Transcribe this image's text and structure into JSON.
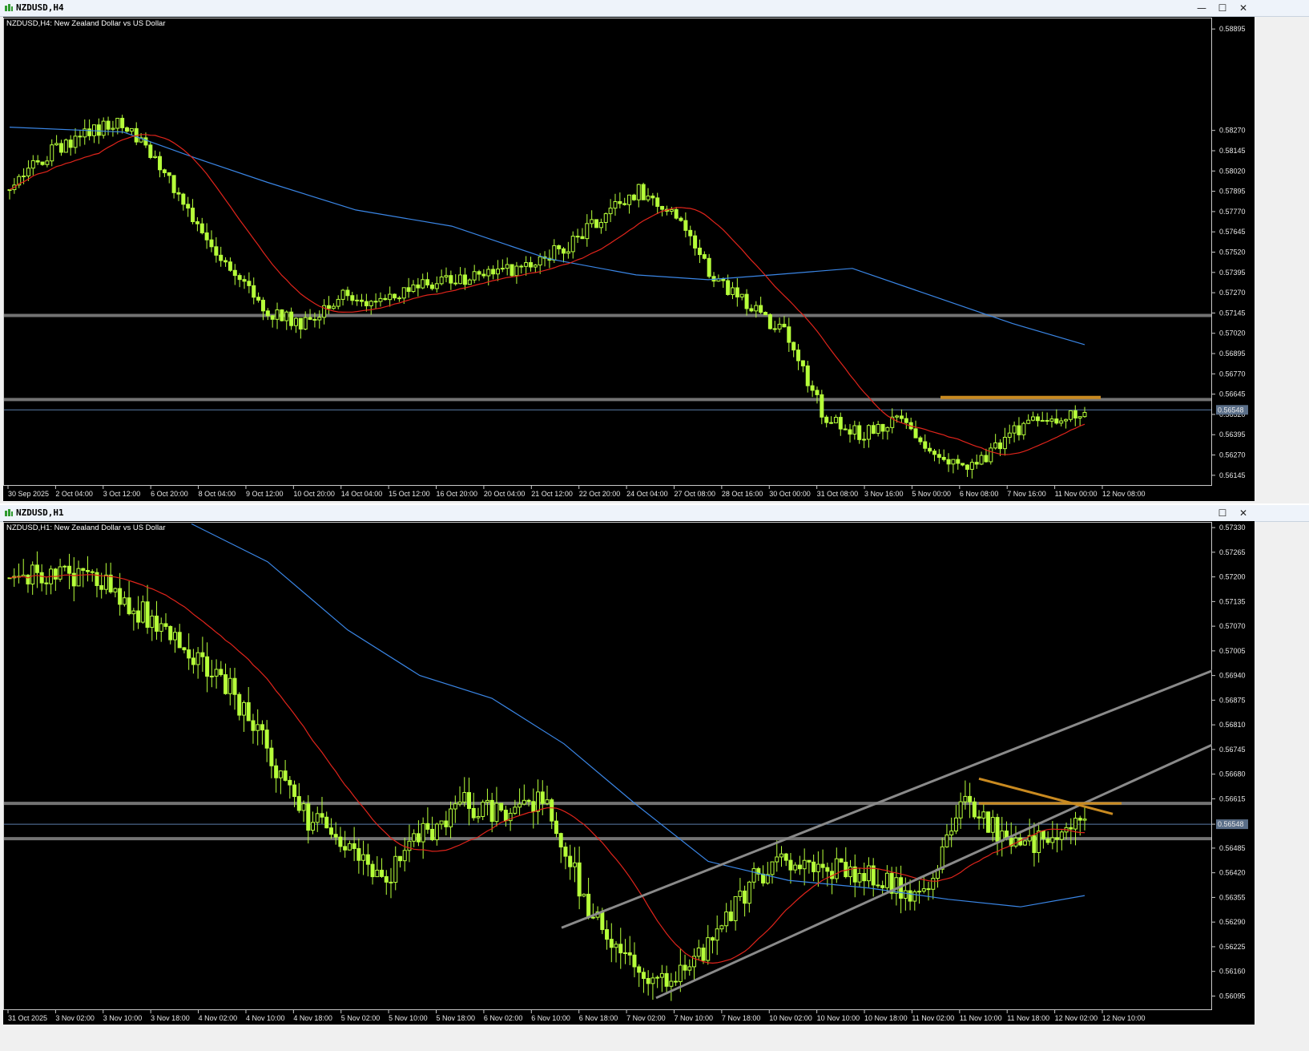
{
  "windows": [
    {
      "id": "h4",
      "title": "NZDUSD,H4",
      "info_label": "NZDUSD,H4:  New Zealand Dollar vs US Dollar",
      "price_labels": [
        "0.58895",
        "0.58270",
        "0.58145",
        "0.58020",
        "0.57895",
        "0.57770",
        "0.57645",
        "0.57520",
        "0.57395",
        "0.57270",
        "0.57145",
        "0.57020",
        "0.56895",
        "0.56770",
        "0.56645",
        "0.56520",
        "0.56395",
        "0.56270",
        "0.56145"
      ],
      "current_price": "0.56548",
      "time_labels": [
        "30 Sep 2025",
        "2 Oct 04:00",
        "3 Oct 12:00",
        "6 Oct 20:00",
        "8 Oct 04:00",
        "9 Oct 12:00",
        "10 Oct 20:00",
        "14 Oct 04:00",
        "15 Oct 12:00",
        "16 Oct 20:00",
        "20 Oct 04:00",
        "21 Oct 12:00",
        "22 Oct 20:00",
        "24 Oct 04:00",
        "27 Oct 08:00",
        "28 Oct 16:00",
        "30 Oct 00:00",
        "31 Oct 08:00",
        "3 Nov 16:00",
        "5 Nov 00:00",
        "6 Nov 08:00",
        "7 Nov 16:00",
        "11 Nov 00:00",
        "12 Nov 08:00"
      ],
      "window_buttons": [
        "—",
        "☐",
        "✕"
      ]
    },
    {
      "id": "h1",
      "title": "NZDUSD,H1",
      "info_label": "NZDUSD,H1:  New Zealand Dollar vs US Dollar",
      "price_labels": [
        "0.57330",
        "0.57265",
        "0.57200",
        "0.57135",
        "0.57070",
        "0.57005",
        "0.56940",
        "0.56875",
        "0.56810",
        "0.56745",
        "0.56680",
        "0.56615",
        "0.56548",
        "0.56485",
        "0.56420",
        "0.56355",
        "0.56290",
        "0.56225",
        "0.56160",
        "0.56095"
      ],
      "current_price": "0.56548",
      "time_labels": [
        "31 Oct 2025",
        "3 Nov 02:00",
        "3 Nov 10:00",
        "3 Nov 18:00",
        "4 Nov 02:00",
        "4 Nov 10:00",
        "4 Nov 18:00",
        "5 Nov 02:00",
        "5 Nov 10:00",
        "5 Nov 18:00",
        "6 Nov 02:00",
        "6 Nov 10:00",
        "6 Nov 18:00",
        "7 Nov 02:00",
        "7 Nov 10:00",
        "7 Nov 18:00",
        "10 Nov 02:00",
        "10 Nov 10:00",
        "10 Nov 18:00",
        "11 Nov 02:00",
        "11 Nov 10:00",
        "11 Nov 18:00",
        "12 Nov 02:00",
        "12 Nov 10:00"
      ],
      "window_buttons": [
        "☐",
        "✕"
      ]
    }
  ],
  "colors": {
    "bull": "#b6ff3a",
    "bear": "#ffffff",
    "ma_fast": "#e0241b",
    "ma_slow": "#3a86e6",
    "level": "#7a7a7a",
    "orange": "#c98a20",
    "grid_text": "#e8e8e8"
  },
  "icons": [
    "chart-window-icon"
  ]
}
